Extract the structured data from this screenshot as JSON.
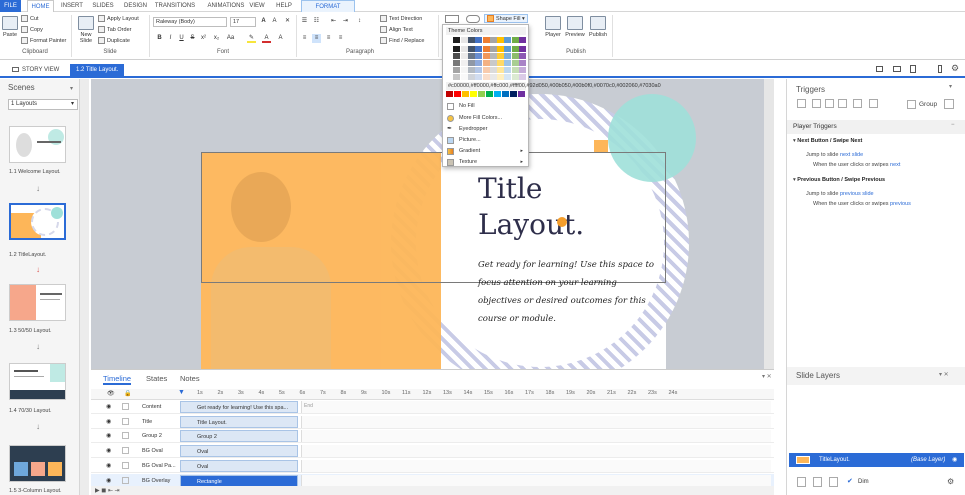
{
  "tabs": [
    "FILE",
    "HOME",
    "INSERT",
    "SLIDES",
    "DESIGN",
    "TRANSITIONS",
    "ANIMATIONS",
    "VIEW",
    "HELP",
    "FORMAT"
  ],
  "ribbon": {
    "paste": "Paste",
    "cut": "Cut",
    "copy": "Copy",
    "format_painter": "Format Painter",
    "clipboard": "Clipboard",
    "new_slide": "New Slide",
    "apply_layout": "Apply Layout",
    "tab_order": "Tab Order",
    "duplicate": "Duplicate",
    "slide": "Slide",
    "font_name": "Raleway (Body)",
    "font_size": "17",
    "font": "Font",
    "text_direction": "Text Direction",
    "align_text": "Align Text",
    "find_replace": "Find / Replace",
    "paragraph": "Paragraph",
    "shape_fill": "Shape Fill",
    "player": "Player",
    "preview": "Preview",
    "publish": "Publish",
    "publish_group": "Publish"
  },
  "doctabs": {
    "story_view": "STORY VIEW",
    "current": "1.2 Title Layout."
  },
  "scenes": {
    "title": "Scenes",
    "dropdown": "1 Layouts",
    "items": [
      "1.1 Welcome Layout.",
      "1.2 TitleLayout.",
      "1.3 50/50 Layout.",
      "1.4 70/30 Layout.",
      "1.5 3-Column Layout."
    ]
  },
  "slide": {
    "title": "Title Layout.",
    "body": "Get ready for learning! Use this space to focus attention on your learning objectives or desired outcomes for this course or module."
  },
  "colors": {
    "accent": "#2b6bd6",
    "orange": "#fdb659",
    "teal": "#9fe0d9",
    "stripe": "#c8cbe6"
  },
  "timeline": {
    "tabs": [
      "Timeline",
      "States",
      "Notes"
    ],
    "ticks": [
      "1s",
      "2s",
      "3s",
      "4s",
      "5s",
      "6s",
      "7s",
      "8s",
      "9s",
      "10s",
      "11s",
      "12s",
      "13s",
      "14s",
      "15s",
      "16s",
      "17s",
      "18s",
      "19s",
      "20s",
      "21s",
      "22s",
      "23s",
      "24s"
    ],
    "rows": [
      {
        "name": "Content",
        "bar": "Get ready for learning! Use this spa..."
      },
      {
        "name": "Title",
        "bar": "Title Layout."
      },
      {
        "name": "Group 2",
        "bar": "Group 2"
      },
      {
        "name": "BG Oval",
        "bar": "Oval"
      },
      {
        "name": "BG Oval Pa...",
        "bar": "Oval"
      },
      {
        "name": "BG Overlay",
        "bar": "Rectangle"
      }
    ],
    "end_label": "End"
  },
  "triggers": {
    "title": "Triggers",
    "group": "Group",
    "player_triggers": "Player Triggers",
    "t1_title": "Next Button / Swipe Next",
    "t1_l1a": "Jump to slide ",
    "t1_l1b": "next slide",
    "t1_l2a": "When the user clicks or swipes ",
    "t1_l2b": "next",
    "t2_title": "Previous Button / Swipe Previous",
    "t2_l1a": "Jump to slide ",
    "t2_l1b": "previous slide",
    "t2_l2a": "When the user clicks or swipes ",
    "t2_l2b": "previous"
  },
  "layers": {
    "title": "Slide Layers",
    "base_name": "TitleLayout.",
    "base_tag": "(Base Layer)",
    "dim": "Dim"
  },
  "color_menu": {
    "theme": "Theme Colors",
    "standard": [
      "#c00000",
      "#ff0000",
      "#ffc000",
      "#ffff00",
      "#92d050",
      "#00b050",
      "#00b0f0",
      "#0070c0",
      "#002060",
      "#7030a0"
    ],
    "no_fill": "No Fill",
    "more": "More Fill Colors...",
    "eyedropper": "Eyedropper",
    "picture": "Picture...",
    "gradient": "Gradient",
    "texture": "Texture",
    "theme_top": [
      "#ffffff",
      "#1f1f1f",
      "#e7e6e6",
      "#44546a",
      "#4472c4",
      "#ed7d31",
      "#a5a5a5",
      "#ffc000",
      "#5b9bd5",
      "#70ad47",
      "#7030a0"
    ]
  }
}
